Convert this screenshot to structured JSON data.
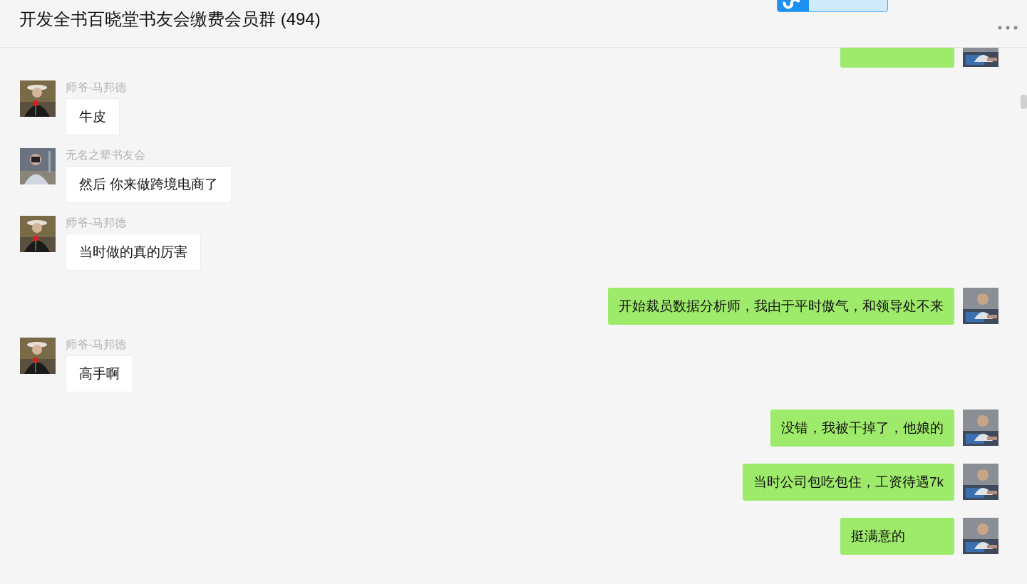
{
  "header": {
    "title": "开发全书百晓堂书友会缴费会员群 (494)"
  },
  "messages": [
    {
      "kind": "sent"
    },
    {
      "kind": "received",
      "sender": "师爷-马邦德",
      "text": "牛皮"
    },
    {
      "kind": "received",
      "sender": "无名之辈书友会",
      "text": "然后 你来做跨境电商了"
    },
    {
      "kind": "received",
      "sender": "师爷-马邦德",
      "text": "当时做的真的厉害"
    },
    {
      "kind": "sent",
      "text": "开始裁员数据分析师，我由于平时傲气，和领导处不来"
    },
    {
      "kind": "received",
      "sender": "师爷-马邦德",
      "text": "高手啊"
    },
    {
      "kind": "sent",
      "text": "没错，我被干掉了，他娘的"
    },
    {
      "kind": "sent",
      "text": "当时公司包吃包住，工资待遇7k"
    },
    {
      "kind": "sent",
      "text": "挺满意的"
    }
  ]
}
